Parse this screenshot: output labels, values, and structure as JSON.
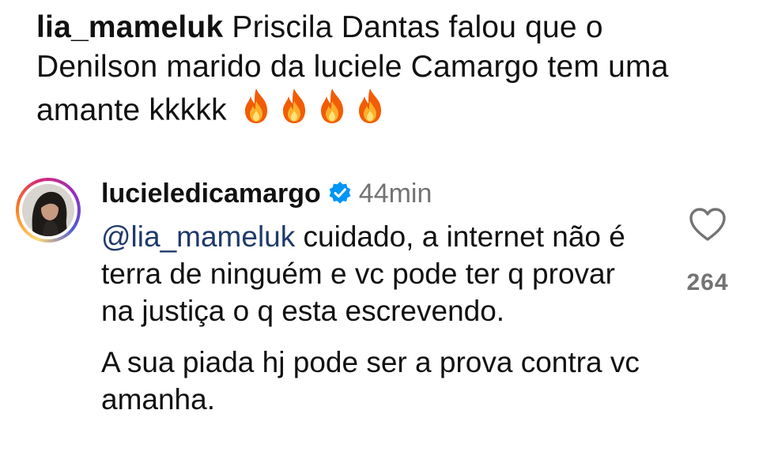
{
  "post_caption": {
    "username": "lia_mameluk",
    "text": "Priscila Dantas falou que o Denilson marido da luciele Camargo tem uma amante kkkkk",
    "emoji_icons": [
      "fire-icon",
      "fire-icon",
      "fire-icon",
      "fire-icon"
    ]
  },
  "reply": {
    "username": "lucieledicamargo",
    "verified": true,
    "timestamp": "44min",
    "mention": "@lia_mameluk",
    "paragraph1": "cuidado, a internet não é terra de ninguém e vc pode ter q provar na justiça o q esta escrevendo.",
    "paragraph2": "A sua piada hj pode ser a prova contra vc amanha.",
    "likes": "264",
    "like_icon": "heart-outline-icon"
  },
  "colors": {
    "text": "#111111",
    "muted": "#737373",
    "verified_badge": "#0095f6",
    "mention": "#1f3a6b"
  }
}
